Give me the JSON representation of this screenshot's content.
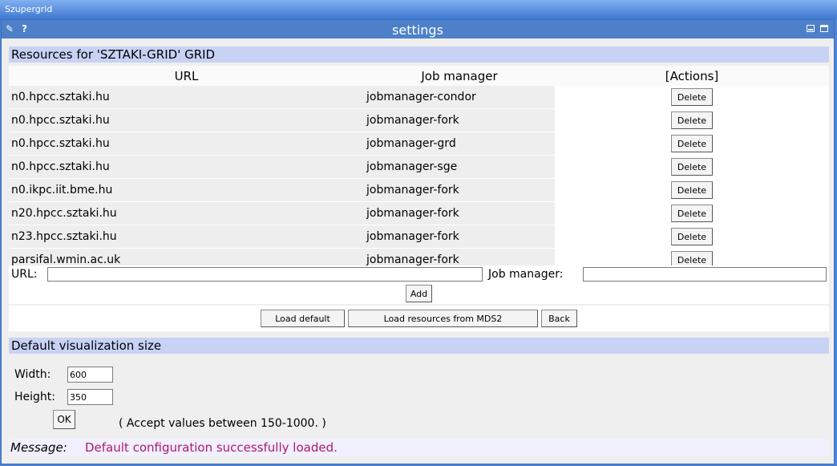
{
  "window": {
    "title": "Szupergrid"
  },
  "portlet": {
    "title": "settings",
    "edit_icon": "pencil-icon",
    "help_label": "?"
  },
  "resources": {
    "heading": "Resources for 'SZTAKI-GRID' GRID",
    "columns": [
      "URL",
      "Job manager",
      "[Actions]"
    ],
    "rows": [
      {
        "url": "n0.hpcc.sztaki.hu",
        "job_manager": "jobmanager-condor",
        "action": "Delete"
      },
      {
        "url": "n0.hpcc.sztaki.hu",
        "job_manager": "jobmanager-fork",
        "action": "Delete"
      },
      {
        "url": "n0.hpcc.sztaki.hu",
        "job_manager": "jobmanager-grd",
        "action": "Delete"
      },
      {
        "url": "n0.hpcc.sztaki.hu",
        "job_manager": "jobmanager-sge",
        "action": "Delete"
      },
      {
        "url": "n0.ikpc.iit.bme.hu",
        "job_manager": "jobmanager-fork",
        "action": "Delete"
      },
      {
        "url": "n20.hpcc.sztaki.hu",
        "job_manager": "jobmanager-fork",
        "action": "Delete"
      },
      {
        "url": "n23.hpcc.sztaki.hu",
        "job_manager": "jobmanager-fork",
        "action": "Delete"
      },
      {
        "url": "parsifal.wmin.ac.uk",
        "job_manager": "jobmanager-fork",
        "action": "Delete"
      }
    ],
    "url_label": "URL:",
    "url_value": "",
    "jm_label": "Job manager:",
    "jm_value": "",
    "add_label": "Add",
    "load_default_label": "Load default",
    "load_mds_label": "Load resources from MDS2",
    "back_label": "Back"
  },
  "visualization": {
    "heading": "Default visualization size",
    "width_label": "Width:",
    "width_value": "600",
    "height_label": "Height:",
    "height_value": "350",
    "ok_label": "OK",
    "hint": "( Accept values between 150-1000. )"
  },
  "message": {
    "label": "Message:",
    "text": "Default configuration successfully loaded.",
    "text_color": "#b0186e"
  }
}
